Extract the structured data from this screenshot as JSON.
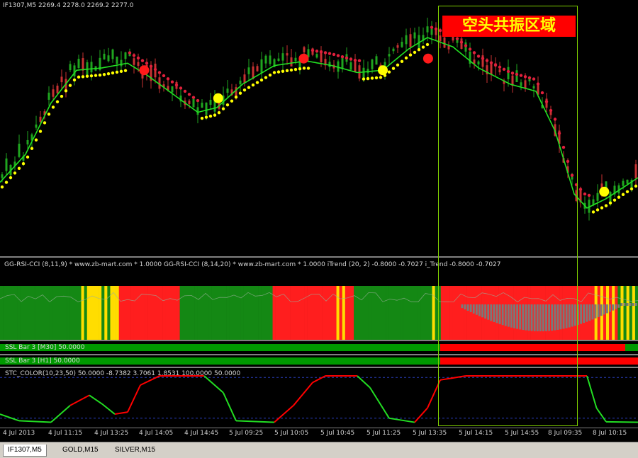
{
  "main_header": "IF1307,M5  2269.4 2278.0 2269.2 2277.0",
  "banner_text": "空头共振区域",
  "ind1_header": "GG-RSI-CCI (8,11,9) * www.zb-mart.com *  1.0000  GG-RSI-CCI (8,14,20) * www.zb-mart.com *  1.0000  iTrend (20, 2) -0.8000 -0.7027  i_Trend -0.8000 -0.7027",
  "ssl1_label": "SSL Bar 3 [M30] 50.0000",
  "ssl2_label": "SSL Bar 3 [H1] 50.0000",
  "stc_label": "STC_COLOR(10,23,50) 50.0000 -8.7382 3.7061 1.8531 100.0000 50.0000",
  "time_ticks": [
    "4 Jul 2013",
    "4 Jul 11:15",
    "4 Jul 13:25",
    "4 Jul 14:05",
    "4 Jul 14:45",
    "5 Jul 09:25",
    "5 Jul 10:05",
    "5 Jul 10:45",
    "5 Jul 11:25",
    "5 Jul 13:35",
    "5 Jul 14:15",
    "5 Jul 14:55",
    "8 Jul 09:35",
    "8 Jul 10:15"
  ],
  "tabs": [
    "IF1307,M5",
    "GOLD,M15",
    "SILVER,M15"
  ],
  "colors": {
    "bull": "#1fa51f",
    "bear": "#c83232",
    "ma": "#22e022",
    "dot_up": "#ffff00",
    "dot_down": "#e0203c",
    "ssl_green": "#009900",
    "ssl_red": "#ff0000",
    "stc_green": "#22dd22",
    "stc_red": "#ff0000",
    "zone": "#7fd000",
    "banner_bg": "#ff0000",
    "banner_fg": "#ffff00"
  },
  "chart_data": {
    "type": "candlestick",
    "title": "IF1307,M5",
    "ohlc_last": {
      "open": 2269.4,
      "high": 2278.0,
      "low": 2269.2,
      "close": 2277.0
    },
    "ma_curve": [
      [
        0,
        0.72
      ],
      [
        0.04,
        0.6
      ],
      [
        0.08,
        0.38
      ],
      [
        0.12,
        0.24
      ],
      [
        0.16,
        0.23
      ],
      [
        0.2,
        0.21
      ],
      [
        0.23,
        0.26
      ],
      [
        0.27,
        0.34
      ],
      [
        0.31,
        0.42
      ],
      [
        0.34,
        0.4
      ],
      [
        0.38,
        0.3
      ],
      [
        0.43,
        0.22
      ],
      [
        0.48,
        0.2
      ],
      [
        0.52,
        0.22
      ],
      [
        0.56,
        0.25
      ],
      [
        0.6,
        0.24
      ],
      [
        0.64,
        0.15
      ],
      [
        0.67,
        0.1
      ],
      [
        0.71,
        0.14
      ],
      [
        0.75,
        0.23
      ],
      [
        0.8,
        0.3
      ],
      [
        0.84,
        0.33
      ],
      [
        0.87,
        0.5
      ],
      [
        0.9,
        0.77
      ],
      [
        0.92,
        0.83
      ],
      [
        0.95,
        0.79
      ],
      [
        1.0,
        0.7
      ]
    ],
    "sar_offset": 0.05,
    "big_dots": [
      {
        "x": 0.226,
        "y": 0.24,
        "c": "red"
      },
      {
        "x": 0.342,
        "y": 0.36,
        "c": "yellow"
      },
      {
        "x": 0.476,
        "y": 0.19,
        "c": "red"
      },
      {
        "x": 0.6,
        "y": 0.24,
        "c": "yellow"
      },
      {
        "x": 0.671,
        "y": 0.19,
        "c": "red"
      },
      {
        "x": 0.947,
        "y": 0.76,
        "c": "yellow"
      }
    ],
    "ind_color_pattern": "GGGGGGGGGGGGGGGGGGGGGGGGGGGGYGYYYYYGYGYYYRRRRRRRRRRRRRRRRRRRRRGGGGGGGGGGGGGGGGGGGGGGGGGGGGGGGGRRRRRRRRRRRRRRRRRRRRRRYRYRRRGGGGGGGGGGGGGGGGGGGGGGGGGGGYGGRRRRRRRRRRRRRRRRRRRRRRRRRRRRRRRRRRRRRRRRRRRRRRRRRRRRRYRYRYRYRGYGYGYG",
    "ssl_m30": [
      [
        0,
        0.26,
        "G"
      ],
      [
        0.26,
        0.69,
        "G"
      ],
      [
        0.69,
        0.98,
        "R"
      ],
      [
        0.98,
        1.0,
        "G"
      ]
    ],
    "ssl_h1": [
      [
        0,
        0.69,
        "G"
      ],
      [
        0.69,
        1.0,
        "R"
      ]
    ],
    "stc_curve": [
      [
        0,
        0.18,
        "G"
      ],
      [
        0.03,
        0.05,
        "G"
      ],
      [
        0.08,
        0.02,
        "G"
      ],
      [
        0.11,
        0.35,
        "G"
      ],
      [
        0.14,
        0.55,
        "R"
      ],
      [
        0.16,
        0.38,
        "G"
      ],
      [
        0.18,
        0.18,
        "G"
      ],
      [
        0.2,
        0.22,
        "R"
      ],
      [
        0.22,
        0.75,
        "R"
      ],
      [
        0.25,
        0.93,
        "R"
      ],
      [
        0.32,
        0.93,
        "R"
      ],
      [
        0.35,
        0.6,
        "G"
      ],
      [
        0.37,
        0.05,
        "G"
      ],
      [
        0.43,
        0.02,
        "G"
      ],
      [
        0.46,
        0.35,
        "R"
      ],
      [
        0.49,
        0.8,
        "R"
      ],
      [
        0.51,
        0.93,
        "R"
      ],
      [
        0.56,
        0.93,
        "R"
      ],
      [
        0.58,
        0.7,
        "G"
      ],
      [
        0.61,
        0.1,
        "G"
      ],
      [
        0.65,
        0.02,
        "G"
      ],
      [
        0.67,
        0.3,
        "R"
      ],
      [
        0.69,
        0.85,
        "R"
      ],
      [
        0.73,
        0.93,
        "R"
      ],
      [
        0.92,
        0.93,
        "R"
      ],
      [
        0.935,
        0.3,
        "G"
      ],
      [
        0.95,
        0.03,
        "G"
      ],
      [
        1.0,
        0.02,
        "G"
      ]
    ],
    "stc_levels": [
      0.1,
      0.9
    ]
  }
}
